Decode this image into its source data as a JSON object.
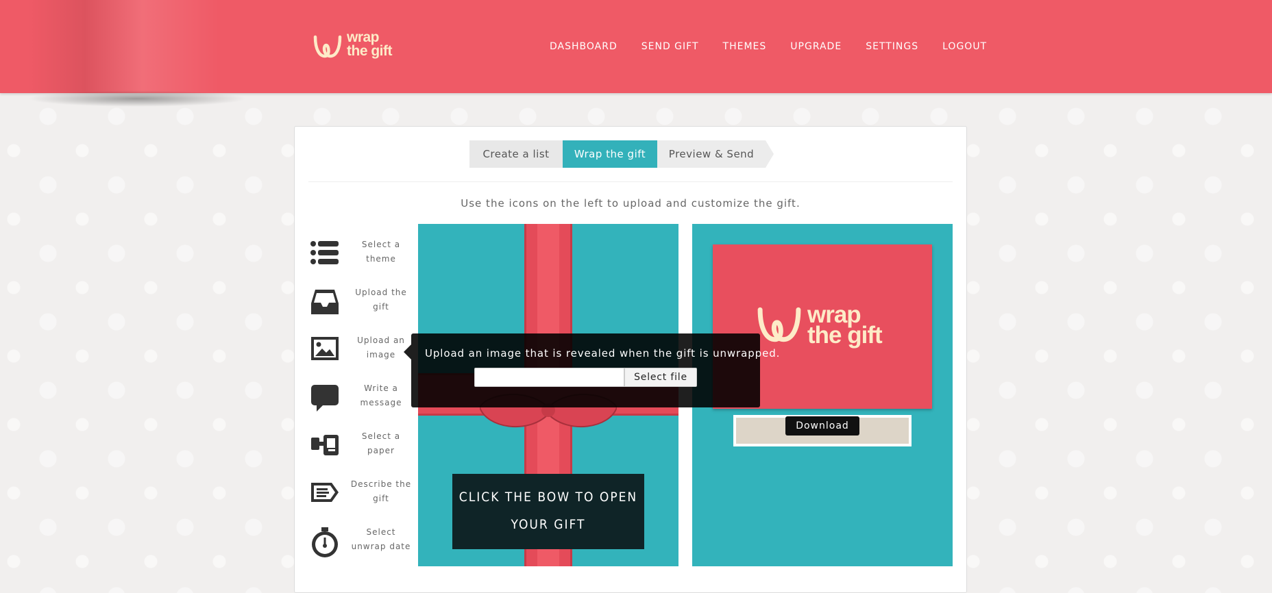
{
  "header": {
    "logo": {
      "line1": "wrap",
      "line2": "the gift"
    },
    "nav": [
      "DASHBOARD",
      "SEND GIFT",
      "THEMES",
      "UPGRADE",
      "SETTINGS",
      "LOGOUT"
    ]
  },
  "steps": [
    {
      "label": "Create a list",
      "active": false
    },
    {
      "label": "Wrap the gift",
      "active": true
    },
    {
      "label": "Preview & Send",
      "active": false
    }
  ],
  "instructions": "Use the icons on the left to upload and customize the gift.",
  "tools": [
    {
      "label": "Select a theme",
      "icon": "list-icon"
    },
    {
      "label": "Upload the gift",
      "icon": "inbox-tray-icon"
    },
    {
      "label": "Upload an image",
      "icon": "image-icon"
    },
    {
      "label": "Write a message",
      "icon": "speech-bubble-icon"
    },
    {
      "label": "Select a paper",
      "icon": "paint-roller-icon"
    },
    {
      "label": "Describe the gift",
      "icon": "tag-icon"
    },
    {
      "label": "Select unwrap date",
      "icon": "stopwatch-icon"
    }
  ],
  "gift_panel": {
    "cta": "CLICK THE BOW TO OPEN YOUR GIFT"
  },
  "preview_panel": {
    "logo": {
      "line1": "wrap",
      "line2": "the gift"
    },
    "download_label": "Download"
  },
  "popover": {
    "text": "Upload an image that is revealed when the gift is unwrapped.",
    "file_value": "",
    "select_file_label": "Select file"
  },
  "colors": {
    "header": "#ef5a66",
    "accent_teal": "#33b1ba",
    "logo_cream": "#fdebc8",
    "ribbon_red": "#e44b59"
  }
}
